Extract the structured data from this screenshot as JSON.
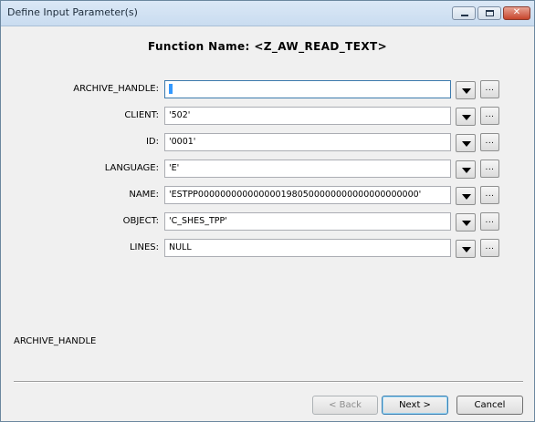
{
  "window": {
    "title": "Define Input Parameter(s)",
    "controls": {
      "minimize": "",
      "maximize": "",
      "close": "✕"
    }
  },
  "header": {
    "function_name": "Function Name: <Z_AW_READ_TEXT>"
  },
  "params": [
    {
      "label": "ARCHIVE_HANDLE:",
      "value": "",
      "active": true
    },
    {
      "label": "CLIENT:",
      "value": "'502'"
    },
    {
      "label": "ID:",
      "value": "'0001'"
    },
    {
      "label": "LANGUAGE:",
      "value": "'E'"
    },
    {
      "label": "NAME:",
      "value": "'ESTPP0000000000000001980500000000000000000000'"
    },
    {
      "label": "OBJECT:",
      "value": "'C_SHES_TPP'"
    },
    {
      "label": "LINES:",
      "value": "NULL"
    }
  ],
  "more_button_label": "...",
  "description": "ARCHIVE_HANDLE",
  "footer": {
    "back_label": "< Back",
    "next_label": "Next >",
    "cancel_label": "Cancel"
  }
}
